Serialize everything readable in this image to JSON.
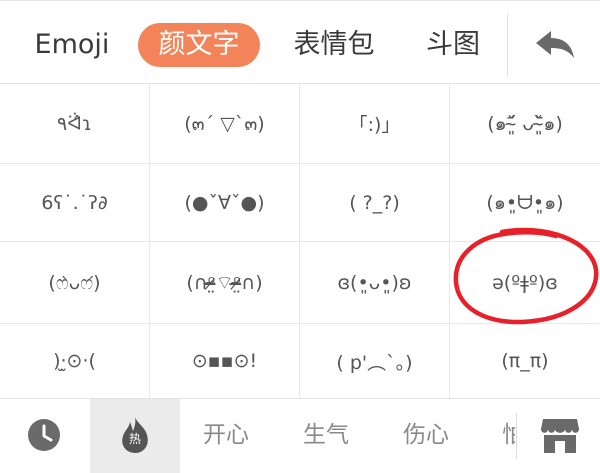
{
  "tabs": {
    "emoji": "Emoji",
    "kaomoji": "颜文字",
    "biaoqing": "表情包",
    "doutu": "斗图"
  },
  "header": {
    "back_icon": "back-arrow-icon"
  },
  "grid": [
    [
      "٩ᐛ̂ɿ",
      "(๓´ ▽`๓)",
      "「:)」",
      "(๑ˇ̴͈᷄ ᴗˇ̴͈᷅๑)"
    ],
    [
      "6ʕ˙.˙ʔ∂",
      "(●ˇ∀ˇ●)",
      "( ?_?)",
      "(๑•͈ᗨ•͈๑)"
    ],
    [
      "(ෆ̀ᴗෆ́)",
      "(∩ᵒ̴̶̷̤⌔ᵒ̴̶̷̤∩)",
      "ɞ(•͈ᴗ•͈)ʚ",
      "ə(ºǂº)ɞ"
    ],
    [
      ")·̫⊙·(",
      "⊙▪▪⊙!",
      "( p'︵`。)",
      "(π_π)"
    ]
  ],
  "annotation": {
    "color": "#e8202a"
  },
  "bottom": {
    "history_icon": "clock-icon",
    "hot_icon": "hot-fire-icon",
    "hot_label": "热",
    "categories": [
      "开心",
      "生气",
      "伤心",
      "怕"
    ],
    "store_icon": "store-icon"
  },
  "colors": {
    "accent": "#f3845a",
    "active_bg": "#ebebeb"
  }
}
